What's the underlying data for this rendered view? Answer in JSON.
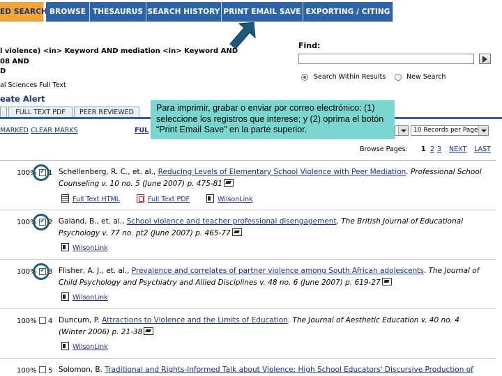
{
  "tabs": [
    {
      "label": "ED SEARCH",
      "active": true
    },
    {
      "label": "BROWSE",
      "active": false
    },
    {
      "label": "THESAURUS",
      "active": false
    },
    {
      "label": "SEARCH HISTORY",
      "active": false
    },
    {
      "label": "PRINT EMAIL SAVE",
      "active": false
    },
    {
      "label": "EXPORTING / CITING",
      "active": false
    }
  ],
  "query": {
    "line1": "l violence) <in> Keyword AND mediation <in> Keyword AND",
    "line2": "08 AND",
    "line3": "D",
    "database": "al Sciences Full Text",
    "create_alert": "eate Alert"
  },
  "find": {
    "label": "Find:",
    "value": "",
    "option_within": "Search Within Results",
    "option_new": "New Search"
  },
  "subtabs": [
    "",
    "FULL TEXT PDF",
    "PEER REVIEWED"
  ],
  "marks": {
    "marked": "MARKED",
    "clear": "CLEAR MARKS",
    "full": "FUL"
  },
  "records_select": "10 Records per Page",
  "pager": {
    "label": "Browse Pages:",
    "pages": [
      "1",
      "2",
      "3"
    ],
    "next": "NEXT",
    "last": "LAST"
  },
  "callout": {
    "text": "Para imprimir, grabar o enviar por correo electrónico: (1)  seleccione los registros que interese; y (2) oprima el botón “Print Email Save” en la parte superior."
  },
  "results": [
    {
      "relevance": "100%",
      "num": "1",
      "checked": true,
      "authors": "Schellenberg, R. C., et. al., ",
      "title": "Reducing Levels of Elementary School Violence with Peer Mediation",
      "journal": "Professional School Counseling",
      "details": " v. 10 no. 5 (June 2007) p. 475-81",
      "links": [
        "Full Text HTML",
        "Full Text PDF",
        "WilsonLink"
      ]
    },
    {
      "relevance": "100%",
      "num": "2",
      "checked": true,
      "authors": "Galand, B., et. al., ",
      "title": "School violence and teacher professional disengagement",
      "journal": "The British Journal of Educational Psychology",
      "details": " v. 77 no. pt2 (June 2007) p. 465-77",
      "links": [
        "WilsonLink"
      ]
    },
    {
      "relevance": "100%",
      "num": "3",
      "checked": true,
      "authors": "Flisher, A. J., et. al., ",
      "title": "Prevalence and correlates of partner violence among South African adolescents",
      "journal": "The Journal of Child Psychology and Psychiatry and Allied Disciplines",
      "details": " v. 48 no. 6 (June 2007) p. 619-27",
      "links": [
        "WilsonLink"
      ]
    },
    {
      "relevance": "100%",
      "num": "4",
      "checked": false,
      "authors": "Duncum, P. ",
      "title": "Attractions to Violence and the Limits of Education",
      "journal": "The Journal of Aesthetic Education",
      "details": " v. 40 no. 4 (Winter 2006) p. 21-38",
      "links": [
        "WilsonLink"
      ]
    },
    {
      "relevance": "100%",
      "num": "5",
      "checked": false,
      "authors": "Solomon, B. ",
      "title": "Traditional and Rights-Informed Talk about Violence: High School Educators' Discursive Production of",
      "journal": "",
      "details": "",
      "links": []
    }
  ],
  "colors": {
    "tab_blue": "#2d64a6",
    "tab_active": "#f2a33a",
    "callout": "#7bd6cf",
    "arrow": "#1d5a7a"
  }
}
